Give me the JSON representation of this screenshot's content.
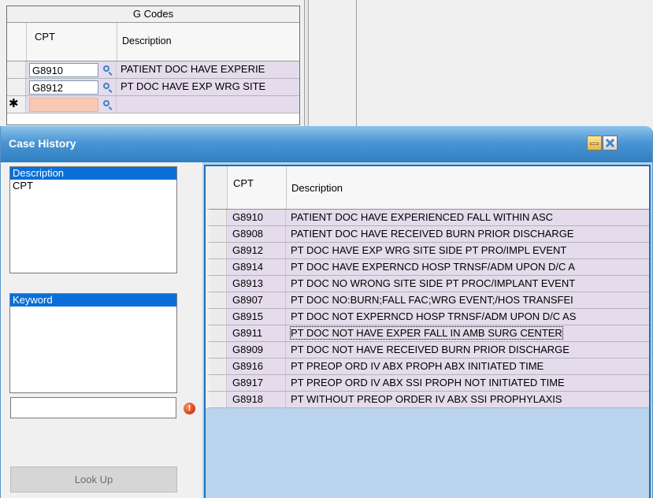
{
  "gcodes": {
    "title": "G Codes",
    "col_cpt": "CPT",
    "col_description": "Description",
    "rows": [
      {
        "cpt": "G8910",
        "description": "PATIENT DOC HAVE EXPERIE"
      },
      {
        "cpt": "G8912",
        "description": "PT DOC HAVE EXP WRG SITE"
      }
    ],
    "new_row_marker": "✱"
  },
  "dialog": {
    "title": "Case History",
    "search_fields": [
      "Description",
      "CPT"
    ],
    "search_fields_selected": "Description",
    "search_modes": [
      "Keyword"
    ],
    "search_modes_selected": "Keyword",
    "search_input_value": "",
    "lookup_label": "Look Up",
    "colors": {
      "titlebar": "#3f8ccb",
      "row_background": "#e4dcec",
      "selection": "#0a6fd8"
    }
  },
  "history": {
    "col_cpt": "CPT",
    "col_description": "Description",
    "rows": [
      {
        "cpt": "G8910",
        "description": "PATIENT DOC HAVE EXPERIENCED FALL WITHIN ASC"
      },
      {
        "cpt": "G8908",
        "description": "PATIENT DOC HAVE RECEIVED BURN PRIOR DISCHARGE"
      },
      {
        "cpt": "G8912",
        "description": "PT DOC HAVE EXP WRG SITE SIDE PT PRO/IMPL EVENT"
      },
      {
        "cpt": "G8914",
        "description": "PT DOC HAVE EXPERNCD HOSP TRNSF/ADM UPON D/C A"
      },
      {
        "cpt": "G8913",
        "description": "PT DOC NO WRONG SITE SIDE PT PROC/IMPLANT EVENT"
      },
      {
        "cpt": "G8907",
        "description": "PT DOC NO:BURN;FALL FAC;WRG EVENT;/HOS TRANSFEI"
      },
      {
        "cpt": "G8915",
        "description": "PT DOC NOT EXPERNCD HOSP TRNSF/ADM UPON D/C AS"
      },
      {
        "cpt": "G8911",
        "description": "PT DOC NOT HAVE EXPER FALL IN AMB SURG CENTER"
      },
      {
        "cpt": "G8909",
        "description": "PT DOC NOT HAVE RECEIVED BURN PRIOR DISCHARGE"
      },
      {
        "cpt": "G8916",
        "description": "PT PREOP ORD IV ABX PROPH ABX INITIATED TIME"
      },
      {
        "cpt": "G8917",
        "description": "PT PREOP ORD IV ABX SSI PROPH NOT INITIATED TIME"
      },
      {
        "cpt": "G8918",
        "description": "PT WITHOUT PREOP ORDER IV ABX SSI PROPHYLAXIS"
      }
    ],
    "focused_row": "G8911"
  }
}
